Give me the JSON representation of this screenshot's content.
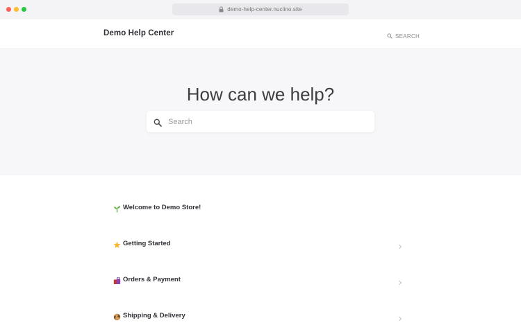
{
  "browser": {
    "url": "demo-help-center.nuclino.site"
  },
  "header": {
    "brand": "Demo Help Center",
    "search_label": "SEARCH"
  },
  "hero": {
    "title": "How can we help?",
    "search_placeholder": "Search"
  },
  "topics": [
    {
      "label": "Welcome to Demo Store!",
      "icon": "seedling-icon",
      "has_chevron": false
    },
    {
      "label": "Getting Started",
      "icon": "star-icon",
      "has_chevron": true
    },
    {
      "label": "Orders & Payment",
      "icon": "shopping-bags-icon",
      "has_chevron": true
    },
    {
      "label": "Shipping & Delivery",
      "icon": "globe-icon",
      "has_chevron": true
    }
  ],
  "colors": {
    "hero_bg": "#f7f7fa",
    "title": "#3d3e42",
    "text": "#2f3035",
    "muted": "#8a8b90"
  }
}
